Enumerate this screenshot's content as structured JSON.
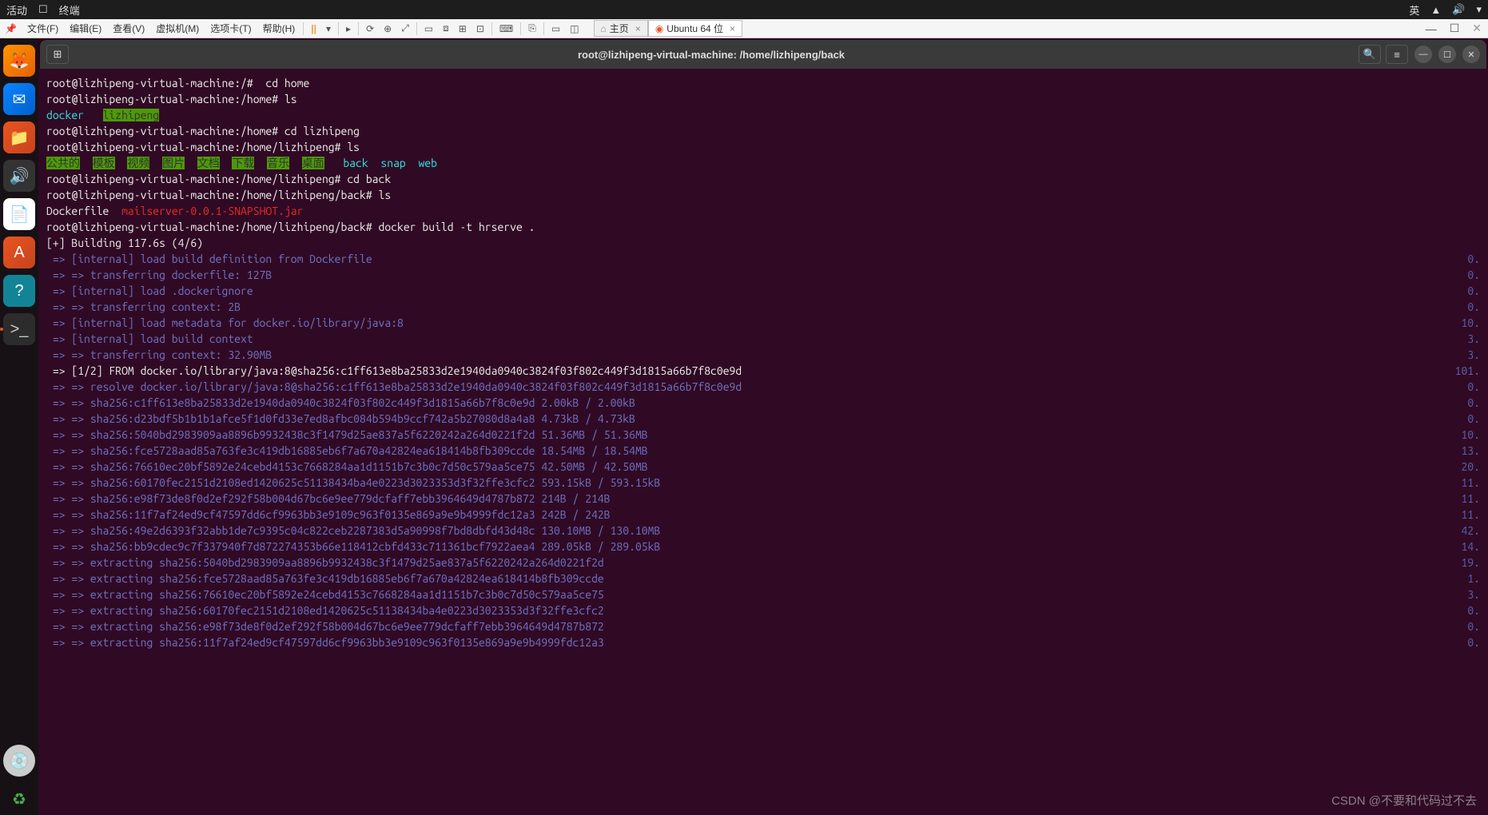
{
  "gnome": {
    "activities": "活动",
    "app_icon": "☐",
    "app_name": "终端",
    "lang": "英",
    "net_icon": "▲",
    "vol_icon": "🔊",
    "power_icon": "▾"
  },
  "vm_menu": {
    "pin": "📌",
    "file": "文件(F)",
    "edit": "编辑(E)",
    "view": "查看(V)",
    "vm": "虚拟机(M)",
    "tabs": "选项卡(T)",
    "help": "帮助(H)",
    "pause": "||",
    "icons": [
      "▸",
      "⟳",
      "⊕",
      "⤢",
      "⟲",
      "⧉"
    ],
    "view_icons": [
      "▭",
      "⧈",
      "⊞",
      "⊡"
    ],
    "tool_icons": [
      "⌨",
      "⎘"
    ],
    "disp_icons": [
      "▭",
      "◫"
    ],
    "tab_home": "主页",
    "tab_ubuntu": "Ubuntu 64 位",
    "close_x": "×",
    "min": "—",
    "max": "☐",
    "close": "✕"
  },
  "term_header": {
    "new_tab": "⊞",
    "title": "root@lizhipeng-virtual-machine: /home/lizhipeng/back",
    "search": "🔍",
    "menu": "≡",
    "min": "—",
    "max": "☐",
    "close": "✕"
  },
  "terminal": {
    "lines": [
      {
        "type": "cmd",
        "prompt": "root@lizhipeng-virtual-machine:/#",
        "cmd": "  cd home"
      },
      {
        "type": "cmd",
        "prompt": "root@lizhipeng-virtual-machine:/home#",
        "cmd": " ls"
      },
      {
        "type": "ls",
        "items": [
          {
            "t": "docker",
            "c": "hl"
          },
          {
            "t": "   "
          },
          {
            "t": "lizhipeng",
            "c": "green"
          }
        ]
      },
      {
        "type": "cmd",
        "prompt": "root@lizhipeng-virtual-machine:/home#",
        "cmd": " cd lizhipeng"
      },
      {
        "type": "cmd",
        "prompt": "root@lizhipeng-virtual-machine:/home/lizhipeng#",
        "cmd": " ls"
      },
      {
        "type": "ls",
        "items": [
          {
            "t": "公共的",
            "c": "green"
          },
          {
            "t": "  "
          },
          {
            "t": "模板",
            "c": "green"
          },
          {
            "t": "  "
          },
          {
            "t": "视频",
            "c": "green"
          },
          {
            "t": "  "
          },
          {
            "t": "图片",
            "c": "green"
          },
          {
            "t": "  "
          },
          {
            "t": "文档",
            "c": "green"
          },
          {
            "t": "  "
          },
          {
            "t": "下载",
            "c": "green"
          },
          {
            "t": "  "
          },
          {
            "t": "音乐",
            "c": "green"
          },
          {
            "t": "  "
          },
          {
            "t": "桌面",
            "c": "green"
          },
          {
            "t": "   "
          },
          {
            "t": "back",
            "c": "hl"
          },
          {
            "t": "  "
          },
          {
            "t": "snap",
            "c": "hl"
          },
          {
            "t": "  "
          },
          {
            "t": "web",
            "c": "hl"
          }
        ]
      },
      {
        "type": "cmd",
        "prompt": "root@lizhipeng-virtual-machine:/home/lizhipeng#",
        "cmd": " cd back"
      },
      {
        "type": "cmd",
        "prompt": "root@lizhipeng-virtual-machine:/home/lizhipeng/back#",
        "cmd": " ls"
      },
      {
        "type": "ls",
        "items": [
          {
            "t": "Dockerfile",
            "c": "plain"
          },
          {
            "t": "  "
          },
          {
            "t": "mailserver-0.0.1-SNAPSHOT.jar",
            "c": "red"
          }
        ]
      },
      {
        "type": "cmd",
        "prompt": "root@lizhipeng-virtual-machine:/home/lizhipeng/back#",
        "cmd": " docker build -t hrserve ."
      },
      {
        "type": "plain",
        "text": "[+] Building 117.6s (4/6)"
      },
      {
        "type": "docker",
        "text": " => [internal] load build definition from Dockerfile",
        "time": "0."
      },
      {
        "type": "docker",
        "text": " => => transferring dockerfile: 127B",
        "time": "0."
      },
      {
        "type": "docker",
        "text": " => [internal] load .dockerignore",
        "time": "0."
      },
      {
        "type": "docker",
        "text": " => => transferring context: 2B",
        "time": "0."
      },
      {
        "type": "docker",
        "text": " => [internal] load metadata for docker.io/library/java:8",
        "time": "10."
      },
      {
        "type": "docker",
        "text": " => [internal] load build context",
        "time": "3."
      },
      {
        "type": "docker",
        "text": " => => transferring context: 32.90MB",
        "time": "3."
      },
      {
        "type": "docker-white",
        "text": " => [1/2] FROM docker.io/library/java:8@sha256:c1ff613e8ba25833d2e1940da0940c3824f03f802c449f3d1815a66b7f8c0e9d",
        "time": "101."
      },
      {
        "type": "docker",
        "text": " => => resolve docker.io/library/java:8@sha256:c1ff613e8ba25833d2e1940da0940c3824f03f802c449f3d1815a66b7f8c0e9d",
        "time": "0."
      },
      {
        "type": "docker",
        "text": " => => sha256:c1ff613e8ba25833d2e1940da0940c3824f03f802c449f3d1815a66b7f8c0e9d 2.00kB / 2.00kB",
        "time": "0."
      },
      {
        "type": "docker",
        "text": " => => sha256:d23bdf5b1b1b1afce5f1d0fd33e7ed8afbc084b594b9ccf742a5b27080d8a4a8 4.73kB / 4.73kB",
        "time": "0."
      },
      {
        "type": "docker",
        "text": " => => sha256:5040bd2983909aa8896b9932438c3f1479d25ae837a5f6220242a264d0221f2d 51.36MB / 51.36MB",
        "time": "10."
      },
      {
        "type": "docker",
        "text": " => => sha256:fce5728aad85a763fe3c419db16885eb6f7a670a42824ea618414b8fb309ccde 18.54MB / 18.54MB",
        "time": "13."
      },
      {
        "type": "docker",
        "text": " => => sha256:76610ec20bf5892e24cebd4153c7668284aa1d1151b7c3b0c7d50c579aa5ce75 42.50MB / 42.50MB",
        "time": "20."
      },
      {
        "type": "docker",
        "text": " => => sha256:60170fec2151d2108ed1420625c51138434ba4e0223d3023353d3f32ffe3cfc2 593.15kB / 593.15kB",
        "time": "11."
      },
      {
        "type": "docker",
        "text": " => => sha256:e98f73de8f0d2ef292f58b004d67bc6e9ee779dcfaff7ebb3964649d4787b872 214B / 214B",
        "time": "11."
      },
      {
        "type": "docker",
        "text": " => => sha256:11f7af24ed9cf47597dd6cf9963bb3e9109c963f0135e869a9e9b4999fdc12a3 242B / 242B",
        "time": "11."
      },
      {
        "type": "docker",
        "text": " => => sha256:49e2d6393f32abb1de7c9395c04c822ceb2287383d5a90998f7bd8dbfd43d48c 130.10MB / 130.10MB",
        "time": "42."
      },
      {
        "type": "docker",
        "text": " => => sha256:bb9cdec9c7f337940f7d872274353b66e118412cbfd433c711361bcf7922aea4 289.05kB / 289.05kB",
        "time": "14."
      },
      {
        "type": "docker",
        "text": " => => extracting sha256:5040bd2983909aa8896b9932438c3f1479d25ae837a5f6220242a264d0221f2d",
        "time": "19."
      },
      {
        "type": "docker",
        "text": " => => extracting sha256:fce5728aad85a763fe3c419db16885eb6f7a670a42824ea618414b8fb309ccde",
        "time": "1."
      },
      {
        "type": "docker",
        "text": " => => extracting sha256:76610ec20bf5892e24cebd4153c7668284aa1d1151b7c3b0c7d50c579aa5ce75",
        "time": "3."
      },
      {
        "type": "docker",
        "text": " => => extracting sha256:60170fec2151d2108ed1420625c51138434ba4e0223d3023353d3f32ffe3cfc2",
        "time": "0."
      },
      {
        "type": "docker",
        "text": " => => extracting sha256:e98f73de8f0d2ef292f58b004d67bc6e9ee779dcfaff7ebb3964649d4787b872",
        "time": "0."
      },
      {
        "type": "docker",
        "text": " => => extracting sha256:11f7af24ed9cf47597dd6cf9963bb3e9109c963f0135e869a9e9b4999fdc12a3",
        "time": "0."
      }
    ]
  },
  "watermark": "CSDN @不要和代码过不去"
}
